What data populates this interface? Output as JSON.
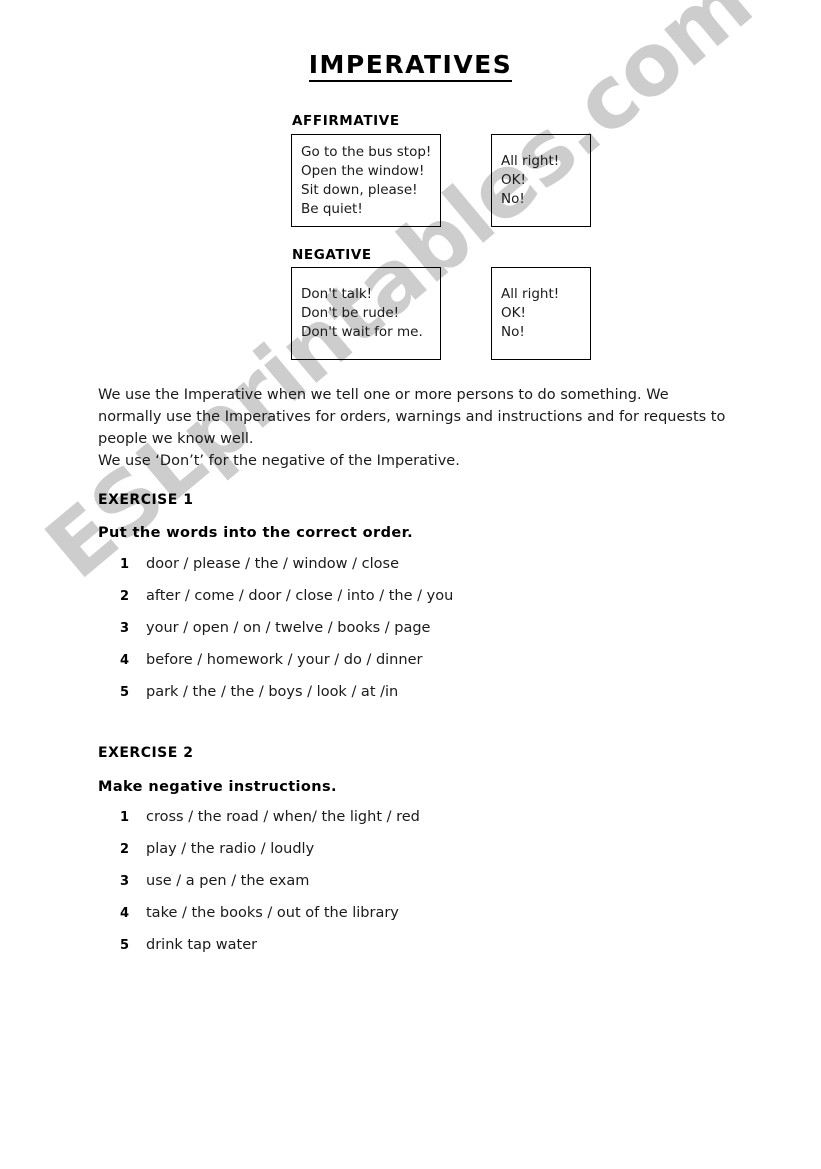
{
  "document": {
    "title": "IMPERATIVES"
  },
  "watermark": {
    "text": "ESLprintables.com",
    "color": "#cdcdcd"
  },
  "affirmative": {
    "label": "AFFIRMATIVE",
    "examples": [
      "Go to the bus stop!",
      "Open the window!",
      "Sit down, please!",
      "Be quiet!"
    ],
    "responses": [
      "All right!",
      "OK!",
      "No!"
    ]
  },
  "negative": {
    "label": "NEGATIVE",
    "examples": [
      "Don't talk!",
      "Don't be rude!",
      "Don't wait for me."
    ],
    "responses": [
      "All right!",
      "OK!",
      "No!"
    ]
  },
  "explanation": {
    "line1": "We use the Imperative when we tell one or more persons to do something. We normally use the Imperatives for orders, warnings and instructions and for requests to people we know well.",
    "line2": "We use ‘Don’t’ for the negative of the Imperative."
  },
  "exercise1": {
    "title": "EXERCISE 1",
    "instruction": "Put the words into the correct order.",
    "items": [
      {
        "number": "1",
        "text": "door / please / the / window / close"
      },
      {
        "number": "2",
        "text": "after / come / door / close / into / the / you"
      },
      {
        "number": "3",
        "text": "your / open / on / twelve / books / page"
      },
      {
        "number": "4",
        "text": "before / homework / your / do / dinner"
      },
      {
        "number": "5",
        "text": "park / the / the / boys / look / at /in"
      }
    ]
  },
  "exercise2": {
    "title": "EXERCISE 2",
    "instruction": "Make negative instructions.",
    "items": [
      {
        "number": "1",
        "text": "cross / the road / when/ the light / red"
      },
      {
        "number": "2",
        "text": "play / the radio / loudly"
      },
      {
        "number": "3",
        "text": "use / a pen / the exam"
      },
      {
        "number": "4",
        "text": "take / the books / out of the library"
      },
      {
        "number": "5",
        "text": "drink tap water"
      }
    ]
  }
}
